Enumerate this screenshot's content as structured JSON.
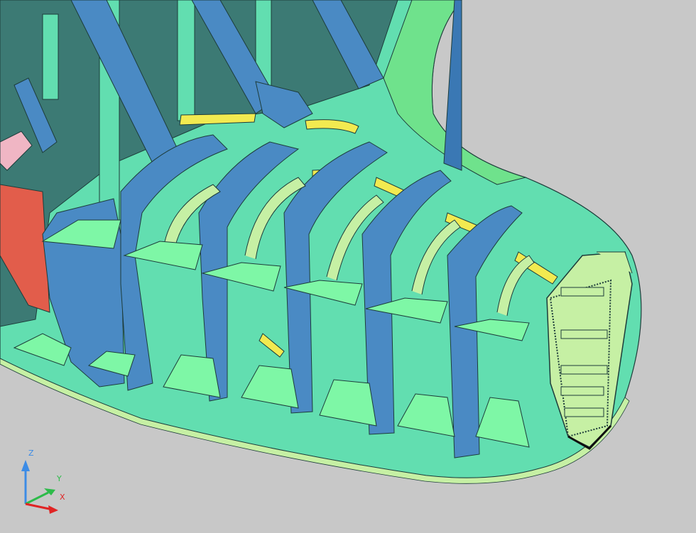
{
  "viewport": {
    "background": "#c8c8c8"
  },
  "model": {
    "palette": {
      "plate_blue": "#4a8ac4",
      "plate_dark_blue": "#3a78b4",
      "shell_teal": "#3c7a74",
      "bracket_green": "#7ef7a6",
      "panel_mint": "#62deb0",
      "stiffener_green": "#6fe28c",
      "longitudinal_yellow": "#f2ea50",
      "frame_light": "#c6f0a4",
      "red_panel": "#e25d4b",
      "pink_panel": "#f0b6c4",
      "edge_dark": "#1d3c3a"
    }
  },
  "ucs": {
    "z_label": "Z",
    "y_label": "Y",
    "x_label": "X",
    "z_color": "#3c8ce6",
    "y_color": "#2dbb4a",
    "x_color": "#e02424"
  }
}
